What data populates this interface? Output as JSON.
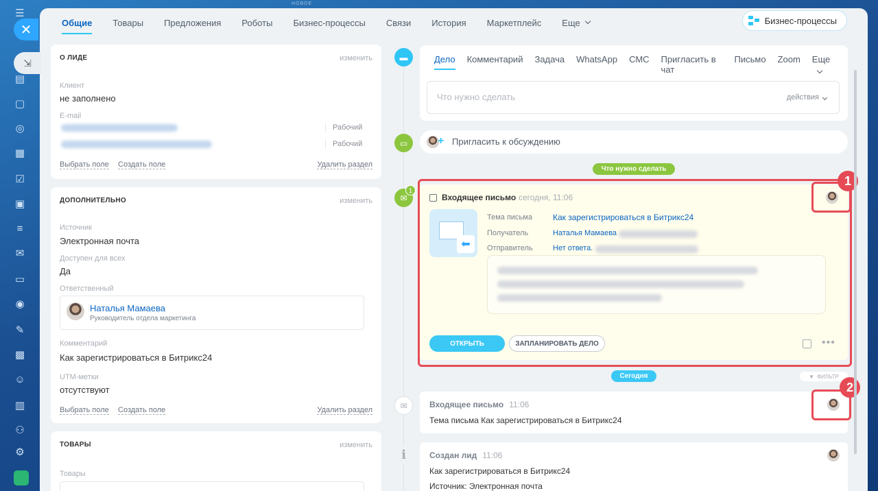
{
  "top_hint": "НОВОЕ",
  "tabs": [
    {
      "label": "Общие"
    },
    {
      "label": "Товары"
    },
    {
      "label": "Предложения"
    },
    {
      "label": "Роботы"
    },
    {
      "label": "Бизнес-процессы"
    },
    {
      "label": "Связи"
    },
    {
      "label": "История"
    },
    {
      "label": "Маркетплейс"
    },
    {
      "label": "Еще"
    }
  ],
  "bp_button": "Бизнес-процессы",
  "about": {
    "title": "О ЛИДЕ",
    "edit": "изменить",
    "client_label": "Клиент",
    "client_value": "не заполнено",
    "email_label": "E-mail",
    "email_type_1": "Рабочий",
    "email_type_2": "Рабочий",
    "choose_field": "Выбрать поле",
    "create_field": "Создать поле",
    "delete_section": "Удалить раздел"
  },
  "extra": {
    "title": "ДОПОЛНИТЕЛЬНО",
    "edit": "изменить",
    "source_label": "Источник",
    "source_value": "Электронная почта",
    "available_label": "Доступен для всех",
    "available_value": "Да",
    "responsible_label": "Ответственный",
    "responsible_name": "Наталья Мамаева",
    "responsible_position": "Руководитель отдела маркетинга",
    "comment_label": "Комментарий",
    "comment_value": "Как зарегистрироваться в Битрикс24",
    "utm_label": "UTM-метки",
    "utm_value": "отсутствуют",
    "choose_field": "Выбрать поле",
    "create_field": "Создать поле",
    "delete_section": "Удалить раздел"
  },
  "products": {
    "title": "ТОВАРЫ",
    "edit": "изменить",
    "products_label": "Товары"
  },
  "editor": {
    "tabs": [
      {
        "label": "Дело"
      },
      {
        "label": "Комментарий"
      },
      {
        "label": "Задача"
      },
      {
        "label": "WhatsApp"
      },
      {
        "label": "СМС"
      },
      {
        "label": "Пригласить в чат"
      },
      {
        "label": "Письмо"
      },
      {
        "label": "Zoom"
      },
      {
        "label": "Еще"
      }
    ],
    "placeholder": "Что нужно сделать",
    "actions": "действия"
  },
  "invite": "Пригласить к обсуждению",
  "pill_todo": "Что нужно сделать",
  "pill_today": "Сегодня",
  "mail_counter": "1",
  "mail": {
    "title": "Входящее письмо",
    "time": "сегодня, 11:06",
    "subject_label": "Тема письма",
    "subject_value": "Как зарегистрироваться в Битрикс24",
    "recipient_label": "Получатель",
    "recipient_value": "Наталья Мамаева",
    "sender_label": "Отправитель",
    "sender_value": "Нет ответа.",
    "open_button": "ОТКРЫТЬ",
    "plan_button": "ЗАПЛАНИРОВАТЬ ДЕЛО"
  },
  "filter": "ФИЛЬТР",
  "history": [
    {
      "title": "Входящее письмо",
      "time": "11:06",
      "text": "Тема письма Как зарегистрироваться в Битрикс24"
    },
    {
      "title": "Создан лид",
      "time": "11:06",
      "text": "Как зарегистрироваться в Битрикс24",
      "text2": "Источник: Электронная почта"
    }
  ],
  "badges": [
    "1",
    "2"
  ],
  "colors": {
    "accent": "#2fc6f6",
    "link": "#0b66c3",
    "highlight": "#e64b55",
    "green": "#8cc63f"
  }
}
